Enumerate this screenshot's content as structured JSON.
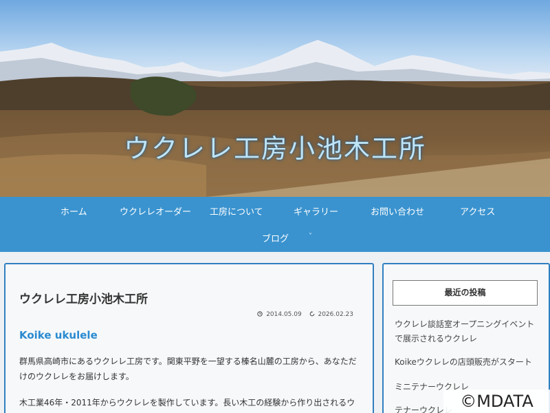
{
  "site": {
    "title": "ウクレレ工房小池木工所"
  },
  "nav": {
    "items": [
      {
        "label": "ホーム"
      },
      {
        "label": "ウクレレオーダー"
      },
      {
        "label": "工房について"
      },
      {
        "label": "ギャラリー"
      },
      {
        "label": "お問い合わせ"
      },
      {
        "label": "アクセス"
      },
      {
        "label": "ブログ"
      }
    ],
    "chevron": "˅"
  },
  "article": {
    "title": "ウクレレ工房小池木工所",
    "published": "2014.05.09",
    "updated": "2026.02.23",
    "subtitle": "Koike ukulele",
    "paragraph1_line1": "群馬県高崎市にあるウクレレ工房です。関東平野を一望する榛名山麓の工房から、あなただ",
    "paragraph1_line2": "けのウクレレをお届けします。",
    "paragraph2_line1": "木工業46年・2011年からウクレレを製作しています。長い木工の経験から作り出されるウ"
  },
  "sidebar": {
    "heading": "最近の投稿",
    "posts": [
      {
        "line1": "ウクレレ談話室オープニングイベント",
        "line2": "で展示されるウクレレ"
      },
      {
        "line1": "Koikeウクレレの店頭販売がスタート",
        "line2": ""
      },
      {
        "line1": "ミニテナーウクレレ",
        "line2": ""
      },
      {
        "line1": "テナーウクレレ",
        "line2": ""
      }
    ]
  },
  "watermark": {
    "text": "©MDATA"
  },
  "icons": {
    "published": "clock-icon",
    "updated": "refresh-icon"
  },
  "colors": {
    "nav": "#3a93cf",
    "accent": "#2a8ad0",
    "border": "#2f7fc0"
  }
}
